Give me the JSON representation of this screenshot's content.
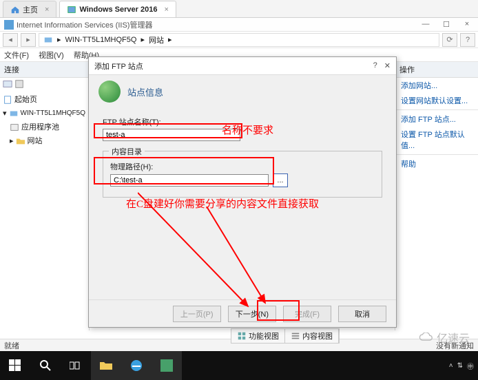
{
  "browser_tabs": {
    "t0": "主页",
    "t1": "Windows Server 2016"
  },
  "iis": {
    "title": "Internet Information Services (IIS)管理器",
    "addr_seg1": "WIN-TT5L1MHQF5Q",
    "addr_seg2": "网站",
    "menu": {
      "file": "文件(F)",
      "view": "视图(V)",
      "help": "帮助(H)"
    }
  },
  "panes": {
    "left_title": "连接",
    "tree": {
      "start": "起始页",
      "server": "WIN-TT5L1MHQF5Q",
      "pool": "应用程序池",
      "sites": "网站"
    },
    "right_title": "操作",
    "actions": {
      "a0": "添加网站...",
      "a1": "设置网站默认设置...",
      "a2": "添加 FTP 站点...",
      "a3": "设置 FTP 站点默认值...",
      "a4": "帮助"
    }
  },
  "dlg": {
    "title": "添加 FTP 站点",
    "heading": "站点信息",
    "name_label": "FTP 站点名称(T):",
    "name_value": "test-a",
    "content_legend": "内容目录",
    "path_label": "物理路径(H):",
    "path_value": "C:\\test-a",
    "browse": "...",
    "prev": "上一页(P)",
    "next": "下一步(N)",
    "finish": "完成(F)",
    "cancel": "取消"
  },
  "ann": {
    "a1": "名称不要求",
    "a2": "在C盘建好你需要分享的内容文件直接获取"
  },
  "midtabs": {
    "t0": "功能视图",
    "t1": "内容视图"
  },
  "status": {
    "left": "就绪",
    "right": "没有新通知"
  },
  "watermark": "亿速云",
  "help_q": "?",
  "close_x": "✕",
  "min": "—",
  "max": "☐",
  "arrow": "▸",
  "arrow_l": "◂",
  "chev": "▾"
}
